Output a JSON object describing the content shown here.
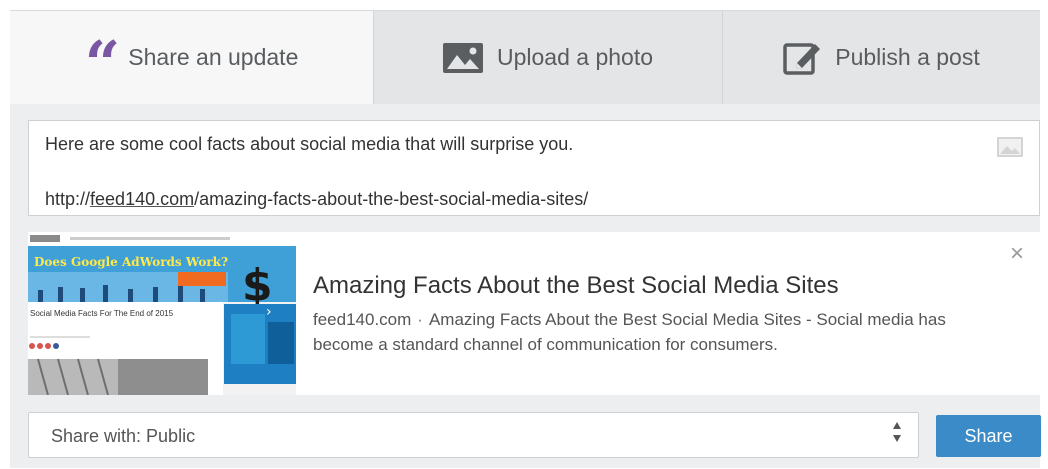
{
  "tabs": [
    {
      "label": "Share an update",
      "icon": "quote-icon",
      "active": true
    },
    {
      "label": "Upload a photo",
      "icon": "photo-icon",
      "active": false
    },
    {
      "label": "Publish a post",
      "icon": "pencil-square-icon",
      "active": false
    }
  ],
  "composer": {
    "text": "Here are some cool facts about social media that will surprise you.",
    "link_prefix": "http://",
    "link_domain": "feed140.com",
    "link_path": "/amazing-facts-about-the-best-social-media-sites/",
    "photo_icon": "image-icon"
  },
  "preview": {
    "title": "Amazing Facts About the Best Social Media Sites",
    "domain": "feed140.com",
    "separator": "·",
    "description": "Amazing Facts About the Best Social Media Sites - Social media has become a standard channel of communication for consumers.",
    "close_glyph": "×",
    "thumbnail": {
      "banner_text": "Does Google AdWords Work?",
      "headline_text": "Social Media Facts For The End of 2015"
    }
  },
  "share_with": {
    "label": "Share with: Public",
    "arrows": "⬍"
  },
  "share_button": {
    "label": "Share"
  },
  "colors": {
    "accent_quote": "#7b57a3",
    "button": "#3a8bc8",
    "panel": "#edeef0",
    "active_tab": "#f7f7f7",
    "inactive_tab": "#e4e5e6"
  }
}
